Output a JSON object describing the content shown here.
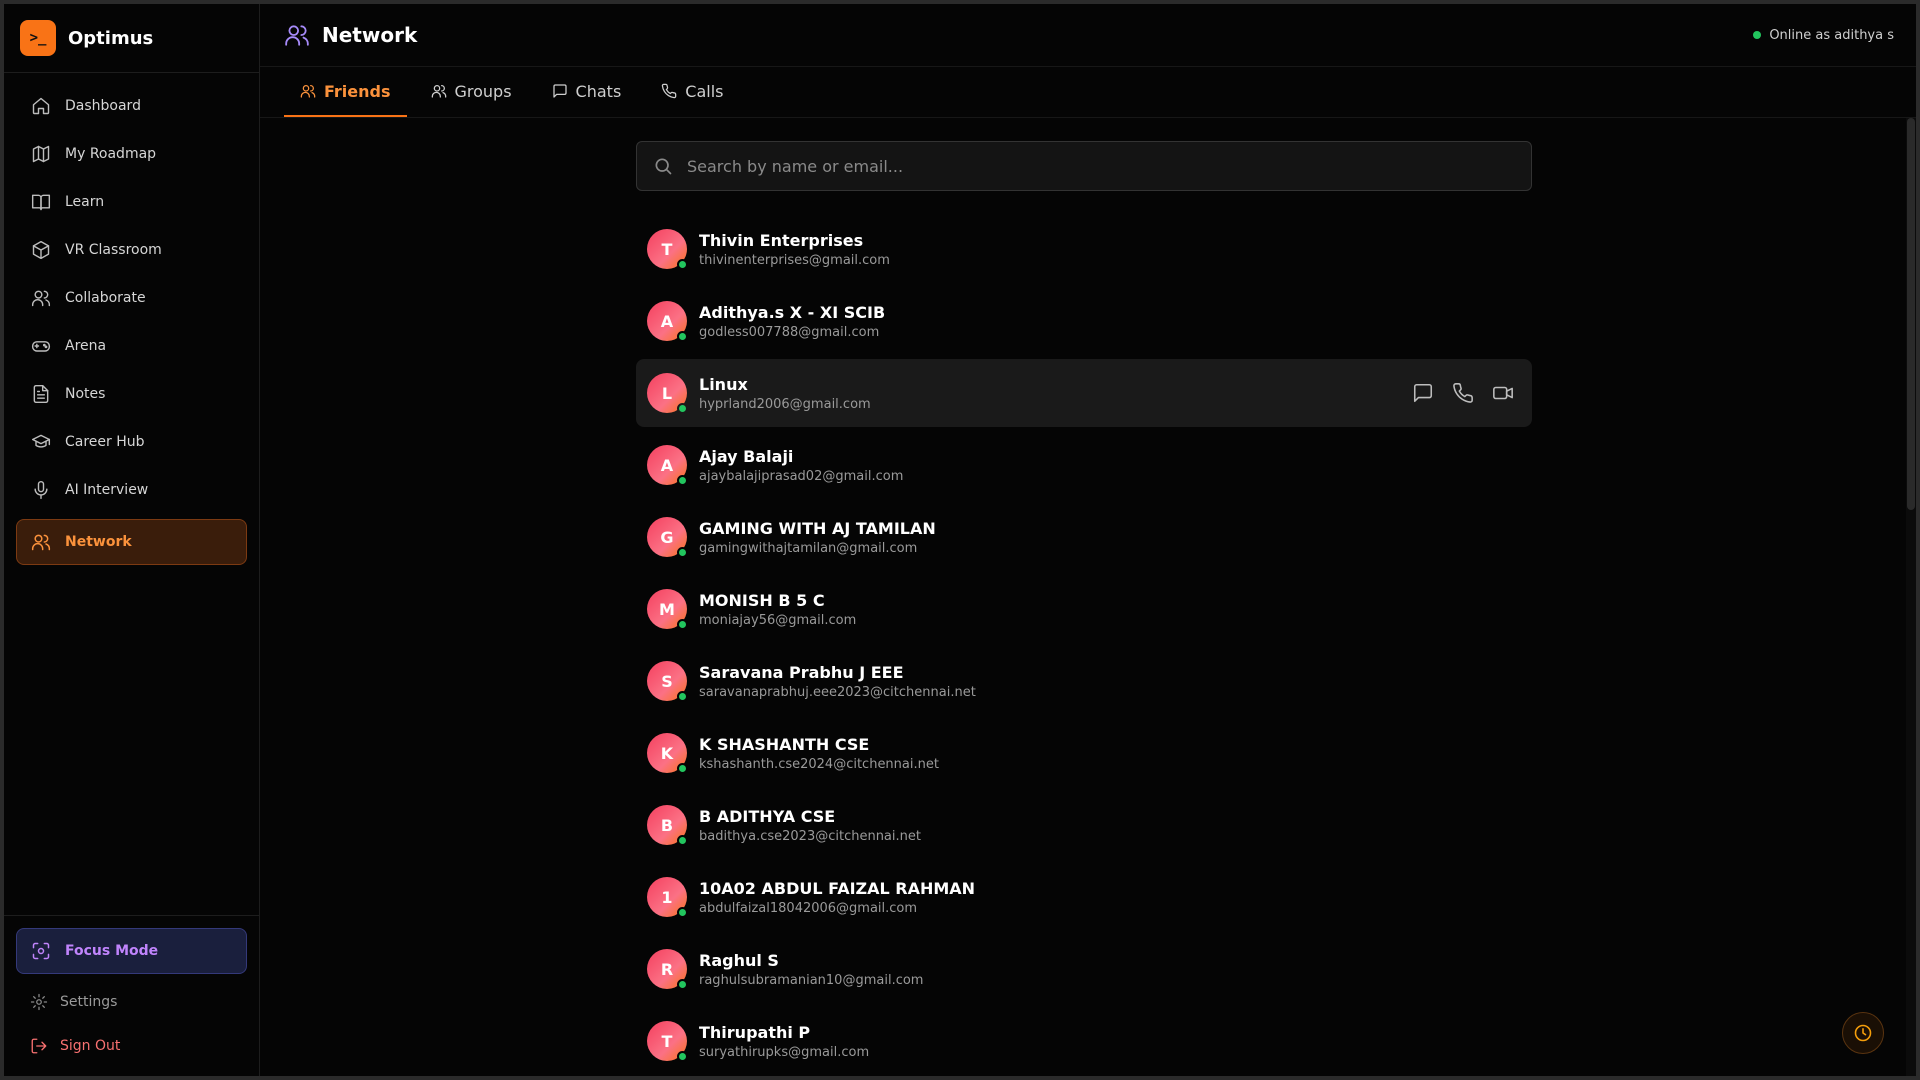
{
  "brand": {
    "logo": ">_",
    "name": "Optimus"
  },
  "sidebar": {
    "items": [
      {
        "label": "Dashboard",
        "icon": "home-icon"
      },
      {
        "label": "My Roadmap",
        "icon": "map-icon"
      },
      {
        "label": "Learn",
        "icon": "book-icon"
      },
      {
        "label": "VR Classroom",
        "icon": "cube-icon"
      },
      {
        "label": "Collaborate",
        "icon": "users-icon"
      },
      {
        "label": "Arena",
        "icon": "gamepad-icon"
      },
      {
        "label": "Notes",
        "icon": "file-text-icon"
      },
      {
        "label": "Career Hub",
        "icon": "graduation-cap-icon"
      },
      {
        "label": "AI Interview",
        "icon": "mic-icon"
      },
      {
        "label": "Network",
        "icon": "users-icon",
        "active": true
      }
    ],
    "focus_mode": "Focus Mode",
    "settings": "Settings",
    "sign_out": "Sign Out"
  },
  "header": {
    "title": "Network",
    "status": "Online as adithya s"
  },
  "tabs": [
    {
      "label": "Friends",
      "active": true
    },
    {
      "label": "Groups"
    },
    {
      "label": "Chats"
    },
    {
      "label": "Calls"
    }
  ],
  "search": {
    "placeholder": "Search by name or email...",
    "value": ""
  },
  "friends": [
    {
      "initial": "T",
      "name": "Thivin Enterprises",
      "email": "thivinenterprises@gmail.com"
    },
    {
      "initial": "A",
      "name": "Adithya.s X - XI SCIB",
      "email": "godless007788@gmail.com"
    },
    {
      "initial": "L",
      "name": "Linux",
      "email": "hyprland2006@gmail.com"
    },
    {
      "initial": "A",
      "name": "Ajay Balaji",
      "email": "ajaybalajiprasad02@gmail.com"
    },
    {
      "initial": "G",
      "name": "GAMING WITH AJ TAMILAN",
      "email": "gamingwithajtamilan@gmail.com"
    },
    {
      "initial": "M",
      "name": "MONISH B 5 C",
      "email": "moniajay56@gmail.com"
    },
    {
      "initial": "S",
      "name": "Saravana Prabhu J EEE",
      "email": "saravanaprabhuj.eee2023@citchennai.net"
    },
    {
      "initial": "K",
      "name": "K SHASHANTH CSE",
      "email": "kshashanth.cse2024@citchennai.net"
    },
    {
      "initial": "B",
      "name": "B ADITHYA CSE",
      "email": "badithya.cse2023@citchennai.net"
    },
    {
      "initial": "1",
      "name": "10A02 ABDUL FAIZAL RAHMAN",
      "email": "abdulfaizal18042006@gmail.com"
    },
    {
      "initial": "R",
      "name": "Raghul S",
      "email": "raghulsubramanian10@gmail.com"
    },
    {
      "initial": "T",
      "name": "Thirupathi P",
      "email": "suryathirupks@gmail.com"
    }
  ],
  "colors": {
    "accent": "#f97316",
    "online": "#22c55e",
    "focus": "#c084fc",
    "danger": "#f87171"
  }
}
